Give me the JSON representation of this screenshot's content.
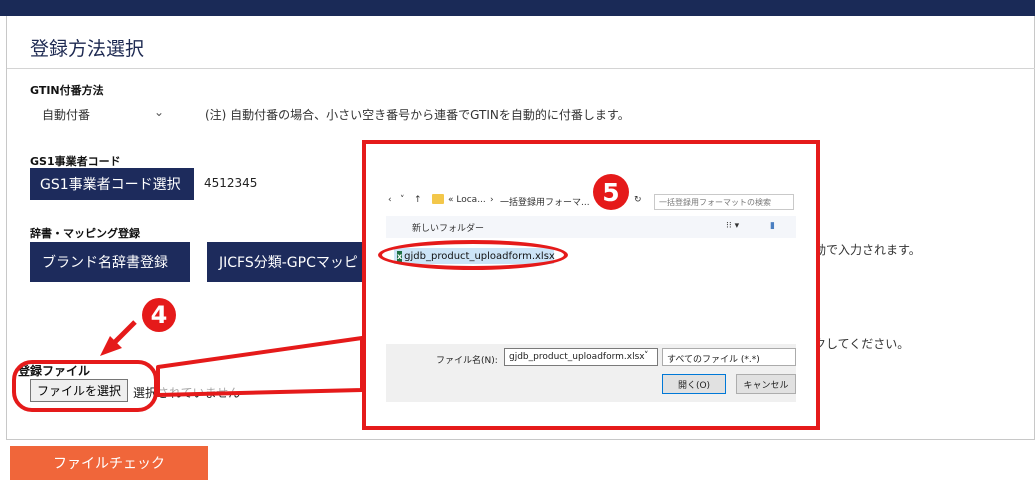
{
  "section_title": "登録方法選択",
  "gtin": {
    "label": "GTIN付番方法",
    "select_value": "自動付番",
    "note": "(注) 自動付番の場合、小さい空き番号から連番でGTINを自動的に付番します。"
  },
  "gs1": {
    "label": "GS1事業者コード",
    "button_label": "GS1事業者コード選択",
    "code_value": "4512345"
  },
  "dictionary": {
    "label": "辞書・マッピング登録",
    "brand_button": "ブランド名辞書登録",
    "jicfs_button": "JICFS分類-GPCマッピ",
    "note_tail": "動で入力されます。"
  },
  "upload": {
    "note_tail": "クしてください。",
    "label": "登録ファイル",
    "choose_button": "ファイルを選択",
    "status": "選択されていません"
  },
  "file_check_button": "ファイルチェック",
  "callouts": {
    "step4": "4",
    "step5": "5"
  },
  "dialog": {
    "nav_left": "‹",
    "nav_down": "˅",
    "nav_up": "↑",
    "path_1": "« Loca...",
    "path_sep": "›",
    "path_2": "一括登録用フォーマ...",
    "refresh_icon": "↻",
    "search_placeholder": "一括登録用フォーマットの検索",
    "new_folder": "新しいフォルダー",
    "view_icon": "⁝⁝ ▾",
    "pane_icon": "▮",
    "file_name": "gjdb_product_uploadform.xlsx",
    "excel_icon_letter": "x",
    "filename_label": "ファイル名(N):",
    "filename_value": "gjdb_product_uploadform.xlsx",
    "filename_chevron": "˅",
    "filter_value": "すべてのファイル (*.*)",
    "open_button": "開く(O)",
    "cancel_button": "キャンセル"
  },
  "colors": {
    "navy": "#1d2b5c",
    "top_bar": "#1a2a57",
    "orange": "#f0663a",
    "annotation_red": "#e51a1a"
  }
}
